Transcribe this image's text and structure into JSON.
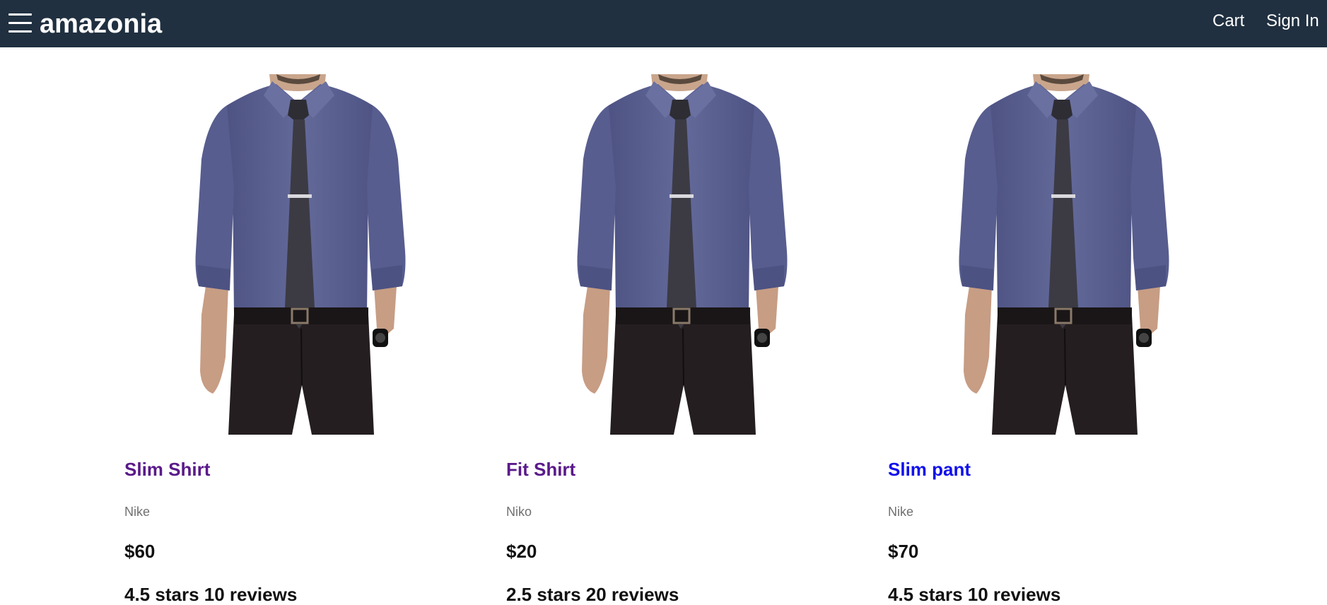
{
  "header": {
    "brand": "amazonia",
    "cart_label": "Cart",
    "signin_label": "Sign In",
    "background_color": "#203040"
  },
  "products": [
    {
      "name": "Slim Shirt",
      "brand": "Nike",
      "price": "$60",
      "rating_text": "4.5 stars 10 reviews",
      "link_state": "visited",
      "image_icon": "shirt-model-image"
    },
    {
      "name": "Fit Shirt",
      "brand": "Niko",
      "price": "$20",
      "rating_text": "2.5 stars 20 reviews",
      "link_state": "visited",
      "image_icon": "shirt-model-image"
    },
    {
      "name": "Slim pant",
      "brand": "Nike",
      "price": "$70",
      "rating_text": "4.5 stars 10 reviews",
      "link_state": "unvisited",
      "image_icon": "shirt-model-image"
    }
  ],
  "colors": {
    "visited_link": "#5a1a8a",
    "unvisited_link": "#1010ee",
    "shirt": "#5b6190",
    "tie": "#3c3b44",
    "pants": "#241e20"
  }
}
